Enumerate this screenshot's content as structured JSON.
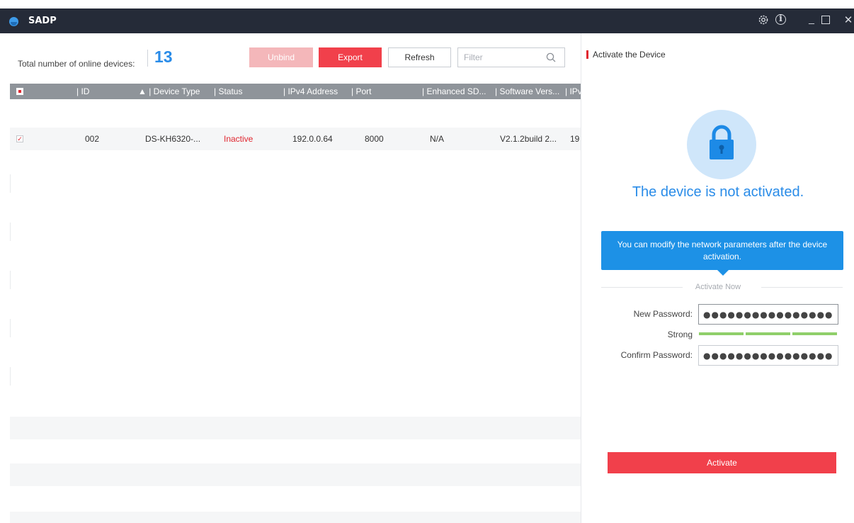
{
  "window": {
    "title": "SADP",
    "icons": [
      "gear-icon",
      "info-icon",
      "minimize-icon",
      "maximize-icon",
      "close-icon"
    ],
    "glyphs": {
      "info": "i",
      "minimize": "_",
      "close": "✕"
    }
  },
  "toolbar": {
    "total_label": "Total number of online devices:",
    "total_count": "13",
    "unbind_label": "Unbind",
    "export_label": "Export",
    "refresh_label": "Refresh",
    "filter_placeholder": "Filter"
  },
  "table": {
    "columns": [
      "| ID",
      "▲ | Device Type",
      "| Status",
      "| IPv4 Address",
      "| Port",
      "| Enhanced SD...",
      "| Software Vers...",
      "| IPv"
    ],
    "rows": [
      {
        "checked": true,
        "id": "002",
        "device_type": "DS-KH6320-...",
        "status": "Inactive",
        "ipv4": "192.0.0.64",
        "port": "8000",
        "enhanced_sdk": "N/A",
        "software_version": "V2.1.2build 2...",
        "ipv4_gateway": "19"
      }
    ]
  },
  "activate_panel": {
    "title": "Activate the Device",
    "status_text": "The device is not activated.",
    "tooltip_text": "You can modify the network parameters after the device activation.",
    "section_label": "Activate Now",
    "new_password_label": "New Password:",
    "new_password_value": "●●●●●●●●●●●●●●●●",
    "strength_label": "Strong",
    "strength_level": 3,
    "strength_max": 3,
    "confirm_password_label": "Confirm Password:",
    "confirm_password_value": "●●●●●●●●●●●●●●●●",
    "activate_label": "Activate"
  },
  "colors": {
    "accent_red": "#f1404b",
    "accent_blue": "#2a8ce8",
    "titlebar": "#252b38",
    "strength_green": "#8fcf6a"
  }
}
